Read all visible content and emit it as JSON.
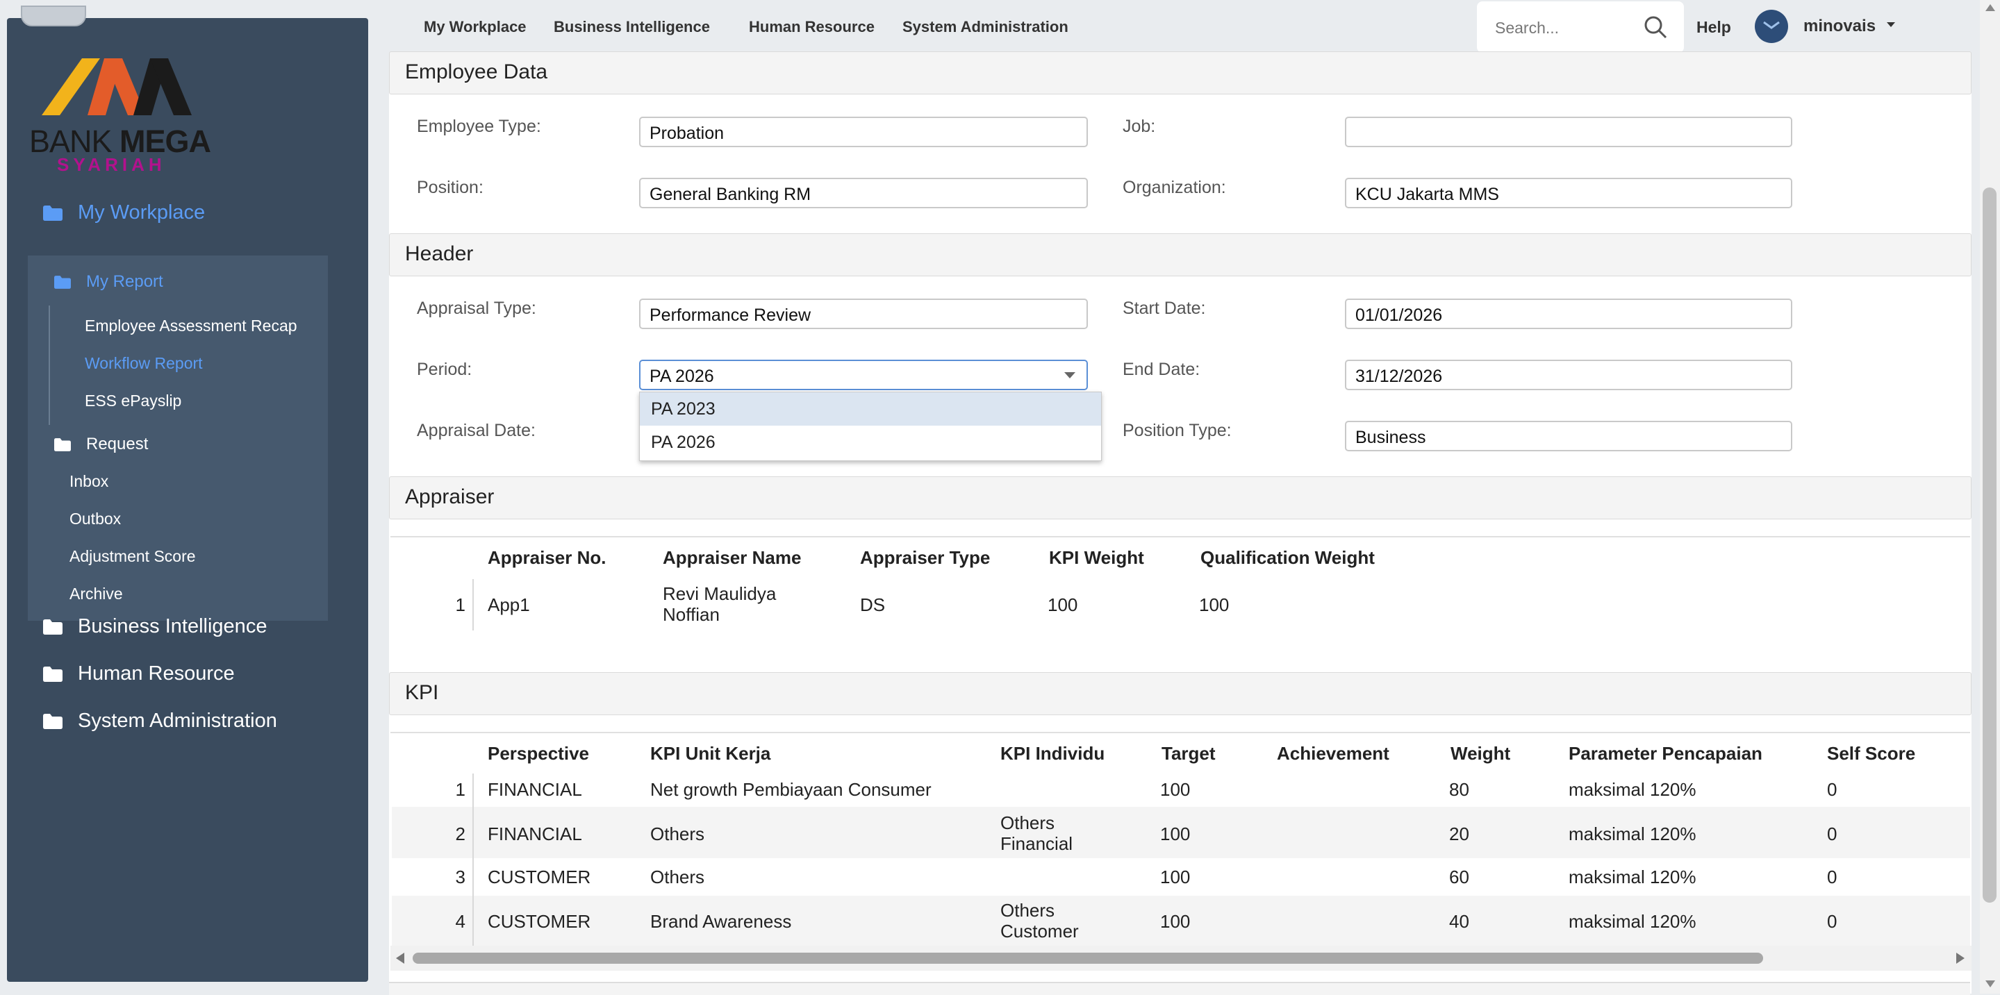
{
  "sidebar": {
    "logo": {
      "text_bold": "MEGA",
      "text_regular": "BANK ",
      "subtitle": "SYARIAH"
    },
    "items": [
      {
        "label": "My Workplace"
      },
      {
        "label": "Business Intelligence"
      },
      {
        "label": "Human Resource"
      },
      {
        "label": "System Administration"
      }
    ],
    "my_report": {
      "label": "My Report",
      "children": [
        "Employee Assessment Recap",
        "Workflow Report",
        "ESS ePayslip"
      ]
    },
    "request": {
      "label": "Request",
      "children": [
        "Inbox",
        "Outbox",
        "Adjustment Score",
        "Archive"
      ]
    }
  },
  "topnav": {
    "items": [
      "My Workplace",
      "Business Intelligence",
      "Human Resource",
      "System Administration"
    ],
    "search_placeholder": "Search...",
    "help": "Help",
    "username": "minovais"
  },
  "employee_data": {
    "title": "Employee Data",
    "employee_type_label": "Employee Type:",
    "employee_type": "Probation",
    "job_label": "Job:",
    "job": "",
    "position_label": "Position:",
    "position": "General Banking RM",
    "organization_label": "Organization:",
    "organization": "KCU Jakarta MMS"
  },
  "header": {
    "title": "Header",
    "appraisal_type_label": "Appraisal Type:",
    "appraisal_type": "Performance Review",
    "start_date_label": "Start Date:",
    "start_date": "01/01/2026",
    "period_label": "Period:",
    "period": "PA 2026",
    "period_options": [
      "PA 2023",
      "PA 2026"
    ],
    "end_date_label": "End Date:",
    "end_date": "31/12/2026",
    "appraisal_date_label": "Appraisal Date:",
    "position_type_label": "Position Type:",
    "position_type": "Business"
  },
  "appraiser": {
    "title": "Appraiser",
    "columns": [
      "Appraiser No.",
      "Appraiser Name",
      "Appraiser Type",
      "KPI Weight",
      "Qualification Weight"
    ],
    "rows": [
      {
        "n": "1",
        "no": "App1",
        "name1": "Revi Maulidya",
        "name2": "Noffian",
        "type": "DS",
        "kpi_weight": "100",
        "qual_weight": "100"
      }
    ]
  },
  "kpi": {
    "title": "KPI",
    "columns": [
      "Perspective",
      "KPI Unit Kerja",
      "KPI Individu",
      "Target",
      "Achievement",
      "Weight",
      "Parameter Pencapaian",
      "Self Score"
    ],
    "rows": [
      {
        "n": "1",
        "perspective": "FINANCIAL",
        "unit": "Net growth Pembiayaan Consumer",
        "ind1": "",
        "ind2": "",
        "target": "100",
        "achievement": "",
        "weight": "80",
        "param": "maksimal 120%",
        "self": "0"
      },
      {
        "n": "2",
        "perspective": "FINANCIAL",
        "unit": "Others",
        "ind1": "Others",
        "ind2": "Financial",
        "target": "100",
        "achievement": "",
        "weight": "20",
        "param": "maksimal 120%",
        "self": "0"
      },
      {
        "n": "3",
        "perspective": "CUSTOMER",
        "unit": "Others",
        "ind1": "",
        "ind2": "",
        "target": "100",
        "achievement": "",
        "weight": "60",
        "param": "maksimal 120%",
        "self": "0"
      },
      {
        "n": "4",
        "perspective": "CUSTOMER",
        "unit": "Brand Awareness",
        "ind1": "Others",
        "ind2": "Customer",
        "target": "100",
        "achievement": "",
        "weight": "40",
        "param": "maksimal 120%",
        "self": "0"
      }
    ]
  },
  "colors": {
    "sidebar": "#3a4b5e",
    "subpanel": "#46596e",
    "accent": "#5b9cf5",
    "logo_pink": "#b2128d",
    "logo_yellow": "#f2b31b",
    "logo_orange": "#e35c2a"
  }
}
